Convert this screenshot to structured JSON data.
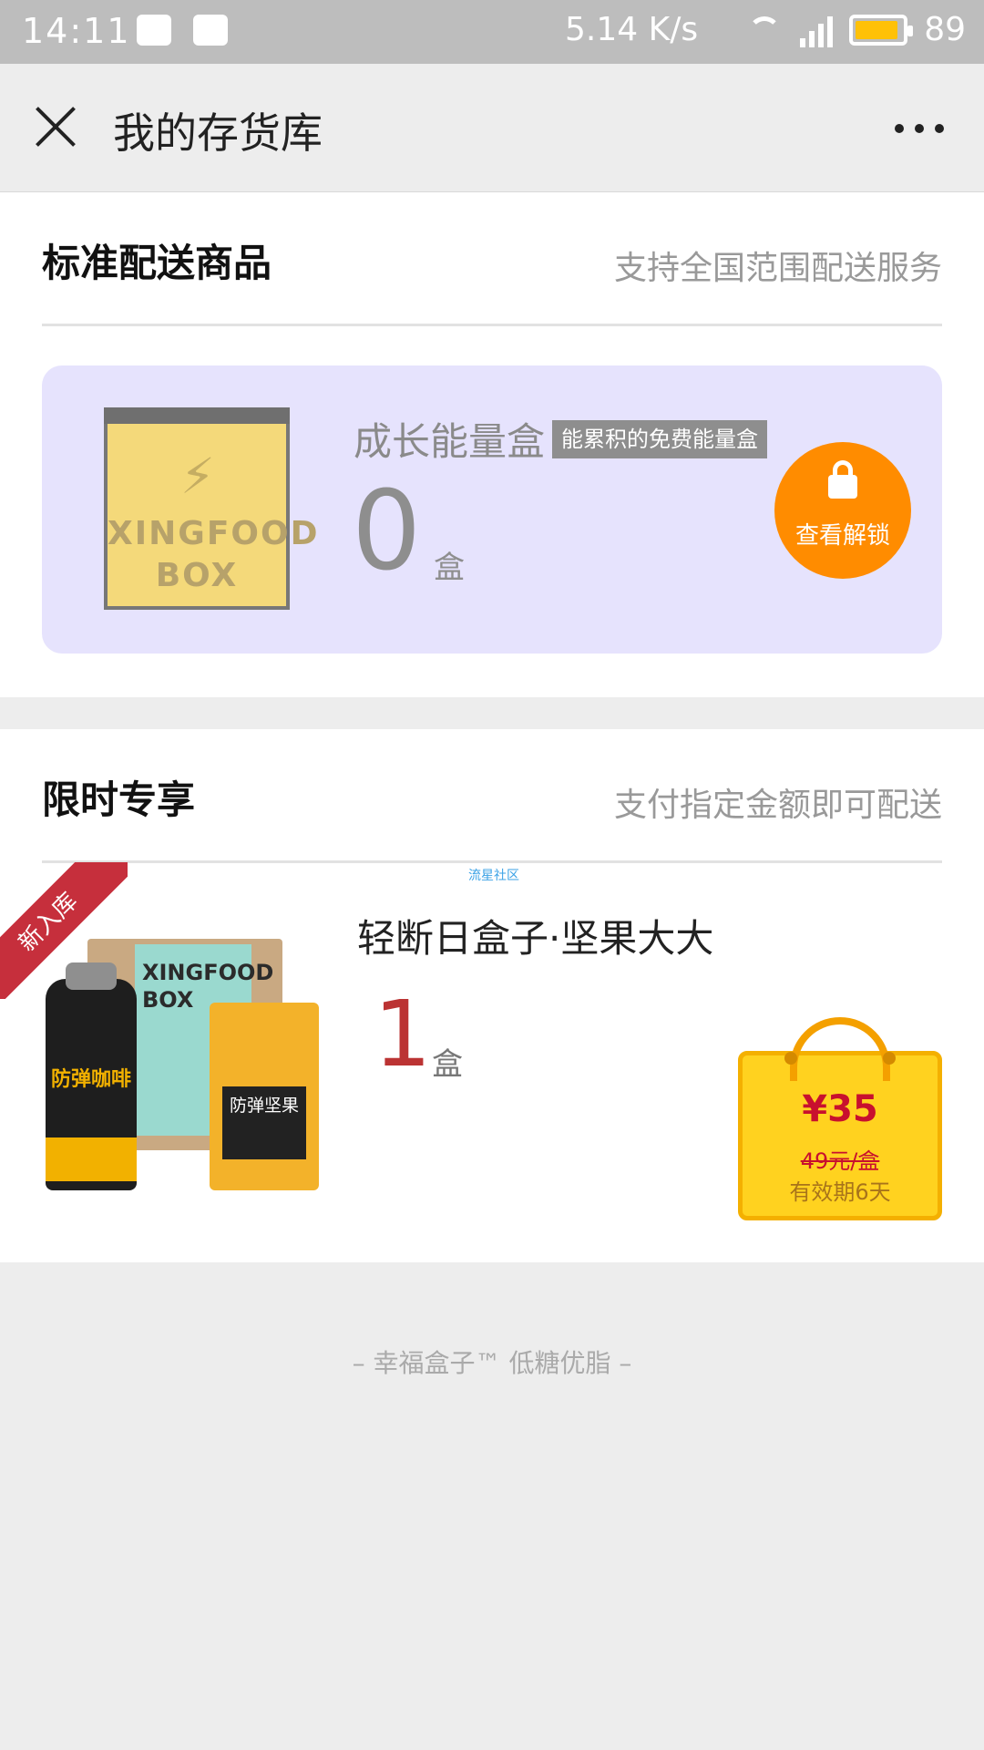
{
  "status_bar": {
    "time": "14:11",
    "net_speed": "5.14 K/s",
    "network": "4G",
    "battery": "89"
  },
  "nav": {
    "title": "我的存货库"
  },
  "standard": {
    "title": "标准配送商品",
    "subtitle": "支持全国范围配送服务",
    "energy_box": {
      "box_text_line1": "XINGFOOD",
      "box_text_line2": "BOX",
      "name": "成长能量盒",
      "tag": "能累积的免费能量盒",
      "count": "0",
      "unit": "盒",
      "unlock_label": "查看解锁"
    }
  },
  "limited": {
    "title": "限时专享",
    "subtitle": "支付指定金额即可配送",
    "watermark": "流星社区",
    "product": {
      "ribbon": "新入库",
      "name": "轻断日盒子·坚果大大",
      "count": "1",
      "unit": "盒",
      "box_text": "XINGFOOD BOX",
      "can_text": "防弹咖啡",
      "bag_text": "防弹坚果",
      "price": "¥35",
      "original_price": "49元/盒",
      "validity": "有效期6天"
    }
  },
  "footer": {
    "text": "– 幸福盒子™ 低糖优脂 –"
  }
}
